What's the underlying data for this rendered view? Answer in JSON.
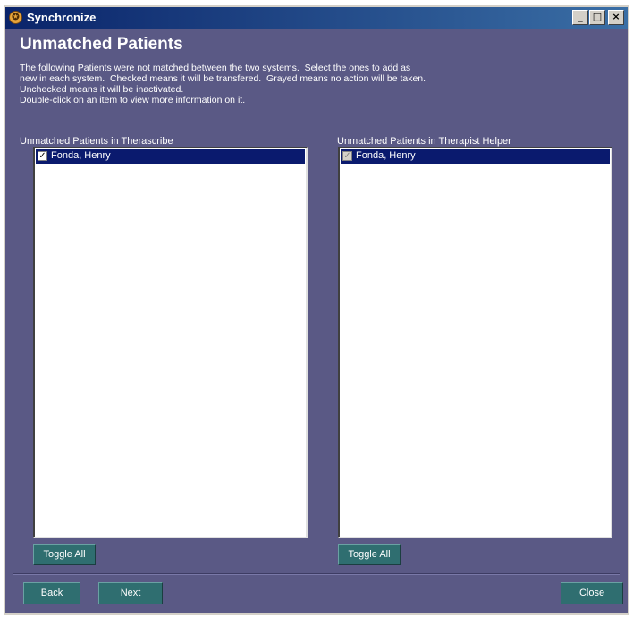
{
  "window": {
    "title": "Synchronize",
    "icon": "app-logo-icon",
    "controls": {
      "minimize": "_",
      "maximize": "□",
      "close": "×"
    }
  },
  "heading": "Unmatched Patients",
  "description": "The following Patients were not matched between the two systems.  Select the ones to add as\nnew in each system.  Checked means it will be transfered.  Grayed means no action will be taken.\nUnchecked means it will be inactivated.\nDouble-click on an item to view more information on it.",
  "left_list": {
    "label": "Unmatched Patients in Therascribe",
    "items": [
      {
        "label": "Fonda, Henry",
        "state": "checked"
      }
    ],
    "toggle_label": "Toggle All"
  },
  "right_list": {
    "label": "Unmatched Patients in Therapist Helper",
    "items": [
      {
        "label": "Fonda, Henry",
        "state": "grayed"
      }
    ],
    "toggle_label": "Toggle All"
  },
  "footer": {
    "back_label": "Back",
    "next_label": "Next",
    "close_label": "Close"
  },
  "colors": {
    "window_background": "#5a5985",
    "button_background": "#2f6e70",
    "selected_item": "#0a1a6e",
    "titlebar": "#0a246a"
  }
}
